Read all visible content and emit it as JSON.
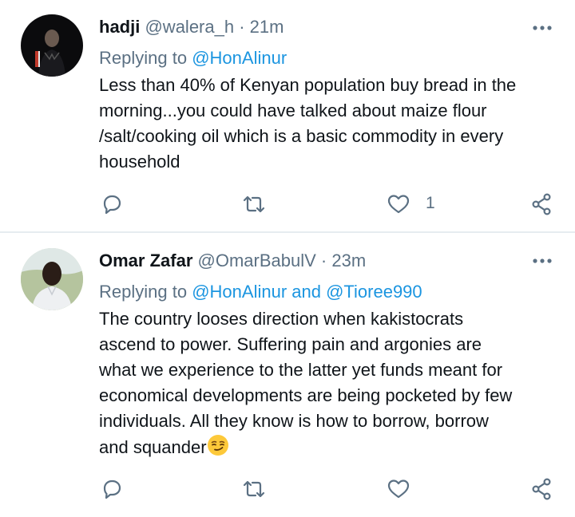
{
  "tweets": [
    {
      "name": "hadji",
      "handle": "@walera_h",
      "separator": "·",
      "time": "21m",
      "replying_prefix": "Replying to",
      "replying_to": "@HonAlinur",
      "body_lines": [
        "Less than 40% of Kenyan population buy bread in the",
        "morning...you could have talked about maize flour",
        "/salt/cooking oil which is a basic commodity in every",
        "household"
      ],
      "like_count": "1",
      "avatar_icon": "avatar-photo"
    },
    {
      "name": "Omar Zafar",
      "handle": "@OmarBabulV",
      "separator": "·",
      "time": "23m",
      "replying_prefix": "Replying to",
      "replying_to": "@HonAlinur and @Tioree990",
      "body_lines": [
        "The country looses direction when kakistocrats",
        "ascend to power. Suffering pain and argonies are",
        "what we experience to the latter yet funds meant for",
        "economical developments are being pocketed by few",
        "individuals. All they know is how to borrow, borrow",
        "and squander"
      ],
      "body_emoji": "smirking-face-emoji",
      "like_count": "",
      "avatar_icon": "avatar-photo"
    }
  ],
  "colors": {
    "text": "#0f1419",
    "secondary": "#5b7083",
    "link": "#1b95e0",
    "divider": "#e6ecf0"
  },
  "icons": [
    "more-icon",
    "reply-icon",
    "retweet-icon",
    "like-icon",
    "share-icon"
  ]
}
